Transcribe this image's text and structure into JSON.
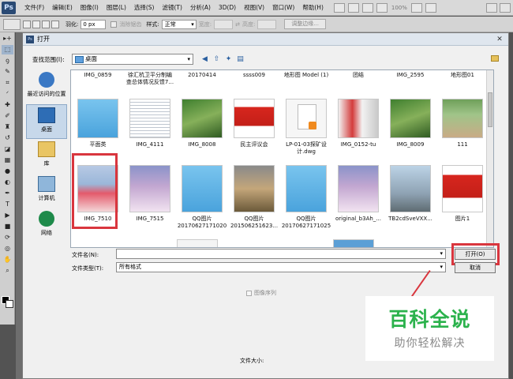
{
  "app": {
    "logo": "Ps",
    "menu": [
      "文件(F)",
      "编辑(E)",
      "图像(I)",
      "图层(L)",
      "选择(S)",
      "滤镜(T)",
      "分析(A)",
      "3D(D)",
      "视图(V)",
      "窗口(W)",
      "帮助(H)"
    ],
    "zoom": "100%"
  },
  "options_bar": {
    "feather_label": "羽化:",
    "feather_value": "0 px",
    "antialias_label": "消除锯齿",
    "style_label": "样式:",
    "style_value": "正常",
    "width_label": "宽度:",
    "height_label": "高度:",
    "refine_label": "调整边缘..."
  },
  "dialog": {
    "title": "打开",
    "look_in_label": "查找范围(I):",
    "look_in_value": "桌面",
    "places": [
      "最近访问的位置",
      "桌面",
      "库",
      "计算机",
      "网络"
    ],
    "files": [
      {
        "name": "IMG_0859",
        "name2": ""
      },
      {
        "name": "徐汇杭卫平分制编",
        "name2": "查总体情况反馈7..."
      },
      {
        "name": "20170414",
        "name2": ""
      },
      {
        "name": "ssss009",
        "name2": ""
      },
      {
        "name": "地形图 Model (1)",
        "name2": ""
      },
      {
        "name": "团结",
        "name2": ""
      },
      {
        "name": "IMG_2595",
        "name2": ""
      },
      {
        "name": "地形图01",
        "name2": ""
      },
      {
        "name": "平面类",
        "name2": ""
      },
      {
        "name": "IMG_4111",
        "name2": ""
      },
      {
        "name": "IMG_8008",
        "name2": ""
      },
      {
        "name": "民主评议会",
        "name2": ""
      },
      {
        "name": "LP-01-03探矿设",
        "name2": "计.dwg"
      },
      {
        "name": "IMG_0152-tu",
        "name2": ""
      },
      {
        "name": "IMG_8009",
        "name2": ""
      },
      {
        "name": "111",
        "name2": ""
      },
      {
        "name": "IMG_7510",
        "name2": ""
      },
      {
        "name": "IMG_7515",
        "name2": ""
      },
      {
        "name": "QQ图片",
        "name2": "20170627171020"
      },
      {
        "name": "QQ图片",
        "name2": "201506251623..."
      },
      {
        "name": "QQ图片",
        "name2": "20170627171025"
      },
      {
        "name": "original_b3Ah_...",
        "name2": ""
      },
      {
        "name": "TB2cdSveVXX...",
        "name2": ""
      },
      {
        "name": "图片1",
        "name2": ""
      }
    ],
    "file_name_label": "文件名(N):",
    "file_name_value": "",
    "file_type_label": "文件类型(T):",
    "file_type_value": "所有格式",
    "open_button": "打开(O)",
    "cancel_button": "取消",
    "image_sequence_label": "图像序列",
    "file_size_label": "文件大小:"
  },
  "watermark": {
    "main": "百科全说",
    "sub": "助你轻松解决"
  },
  "colors": {
    "highlight": "#d9363e",
    "watermark_green": "#2bb24c"
  }
}
